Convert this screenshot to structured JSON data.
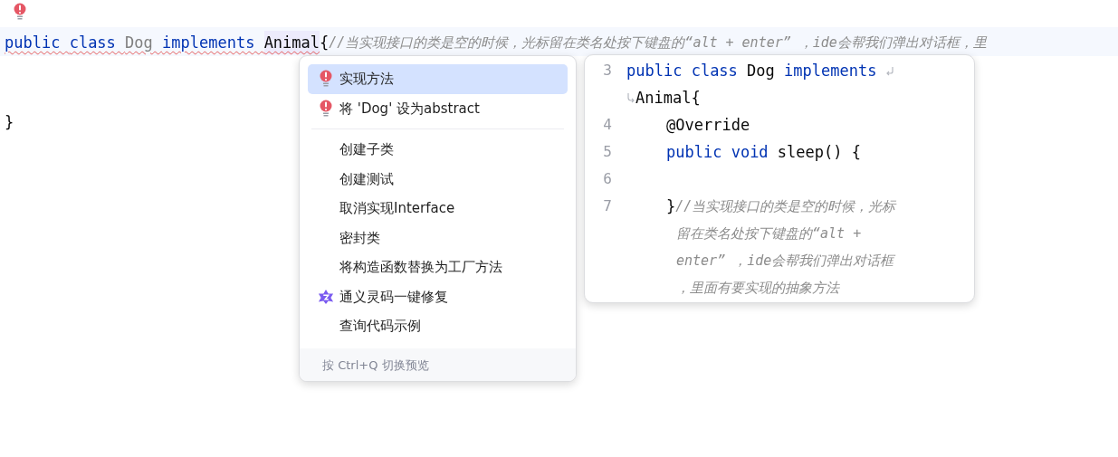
{
  "editor": {
    "lines": [
      {
        "tokens": [
          {
            "text": "public ",
            "kind": "keyword",
            "error": true
          },
          {
            "text": "class ",
            "kind": "keyword",
            "error": true
          },
          {
            "text": "Dog ",
            "kind": "unused",
            "error": true
          },
          {
            "text": "implements ",
            "kind": "keyword",
            "error": true
          },
          {
            "text": "Animal",
            "kind": "plain",
            "error": true,
            "highlighted": true
          },
          {
            "text": "{",
            "kind": "plain",
            "error": false
          },
          {
            "text": "//当实现接口的类是空的时候，光标留在类名处按下键盘的“alt + enter” ，ide会帮我们弹出对话框，里",
            "kind": "comment",
            "error": false
          }
        ]
      },
      {
        "tokens": [
          {
            "text": "}",
            "kind": "plain",
            "error": false
          }
        ]
      }
    ]
  },
  "intention_menu": {
    "groups": [
      [
        {
          "label": "实现方法",
          "kind": "fix",
          "selected": true
        },
        {
          "label": "将 'Dog' 设为abstract",
          "kind": "fix",
          "selected": false
        }
      ],
      [
        {
          "label": "创建子类",
          "kind": "action",
          "selected": false
        },
        {
          "label": "创建测试",
          "kind": "action",
          "selected": false
        },
        {
          "label": "取消实现Interface",
          "kind": "action",
          "selected": false
        },
        {
          "label": "密封类",
          "kind": "action",
          "selected": false
        },
        {
          "label": "将构造函数替换为工厂方法",
          "kind": "action",
          "selected": false
        },
        {
          "label": "通义灵码一键修复",
          "kind": "assistant",
          "selected": false
        },
        {
          "label": "查询代码示例",
          "kind": "action",
          "selected": false
        }
      ]
    ],
    "footer": "按 Ctrl+Q 切换预览"
  },
  "preview": {
    "lines": [
      {
        "kind": "top",
        "number": "3",
        "tokens": [
          {
            "text": "public ",
            "kind": "keyword"
          },
          {
            "text": "class ",
            "kind": "keyword"
          },
          {
            "text": "Dog ",
            "kind": "plain"
          },
          {
            "text": "implements",
            "kind": "keyword"
          }
        ],
        "wraps": true
      },
      {
        "kind": "wrap",
        "tokens": [
          {
            "text": "Animal{",
            "kind": "plain"
          }
        ],
        "wraps": false
      },
      {
        "kind": "member",
        "number": "4",
        "tokens": [
          {
            "text": "@Override",
            "kind": "plain"
          }
        ],
        "wraps": false
      },
      {
        "kind": "member",
        "number": "5",
        "tokens": [
          {
            "text": "public ",
            "kind": "keyword"
          },
          {
            "text": "void ",
            "kind": "keyword"
          },
          {
            "text": "sleep() {",
            "kind": "plain"
          }
        ],
        "wraps": false
      },
      {
        "kind": "member",
        "number": "6",
        "wraps": false
      },
      {
        "kind": "member",
        "number": "7",
        "tokens": [
          {
            "text": "}",
            "kind": "plain"
          },
          {
            "text": "//当实现接口的类是空的时候，光标",
            "kind": "comment"
          }
        ],
        "wraps": false
      },
      {
        "kind": "member-wrap",
        "tokens": [
          {
            "text": "留在类名处按下键盘的“alt +",
            "kind": "comment"
          }
        ],
        "wraps": false
      },
      {
        "kind": "member-wrap",
        "tokens": [
          {
            "text": "enter” ，ide会帮我们弹出对话框",
            "kind": "comment"
          }
        ],
        "wraps": false
      },
      {
        "kind": "member-wrap",
        "tokens": [
          {
            "text": "，里面有要实现的抽象方法",
            "kind": "comment"
          }
        ],
        "wraps": false
      }
    ]
  }
}
